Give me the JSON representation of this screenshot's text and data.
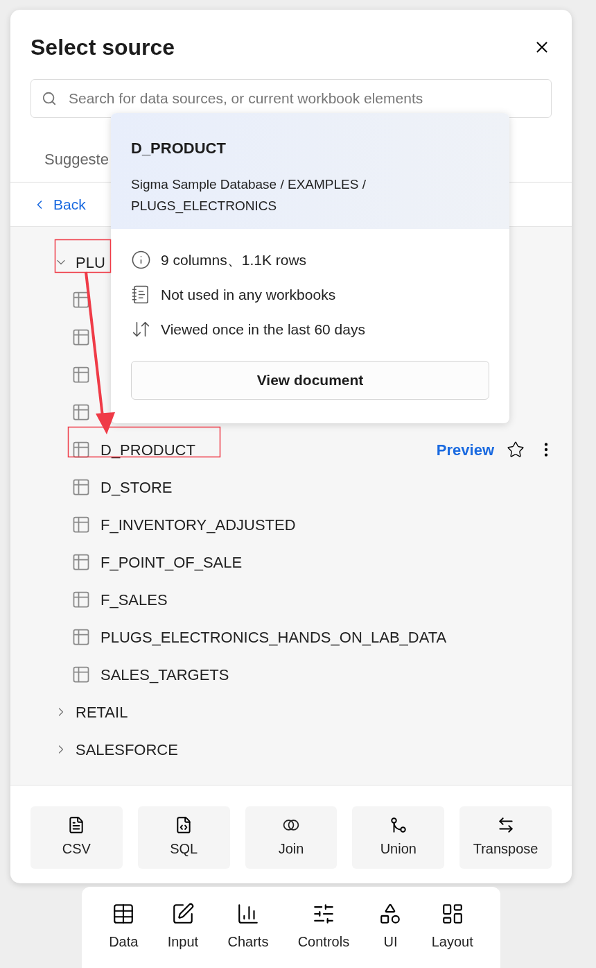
{
  "dialog": {
    "title": "Select source",
    "search": {
      "placeholder": "Search for data sources, or current workbook elements"
    },
    "tabs": [
      {
        "label": "Suggeste"
      }
    ],
    "back": "Back",
    "tree": [
      {
        "name": "PLU",
        "expanded": true,
        "children": [
          {
            "kind": "table",
            "hovered": false
          },
          {
            "kind": "table",
            "hovered": false
          },
          {
            "kind": "table",
            "hovered": false
          },
          {
            "kind": "table",
            "hovered": false
          },
          {
            "kind": "table",
            "name": "D_PRODUCT",
            "hovered": true,
            "action": "Preview",
            "starred": false
          },
          {
            "kind": "table",
            "name": "D_STORE",
            "hovered": false
          },
          {
            "kind": "table",
            "name": "F_INVENTORY_ADJUSTED",
            "hovered": false
          },
          {
            "kind": "table",
            "name": "F_POINT_OF_SALE",
            "hovered": false
          },
          {
            "kind": "table",
            "name": "F_SALES",
            "hovered": false
          },
          {
            "kind": "table",
            "name": "PLUGS_ELECTRONICS_HANDS_ON_LAB_DATA",
            "hovered": false
          },
          {
            "kind": "table",
            "name": "SALES_TARGETS",
            "hovered": false
          }
        ]
      },
      {
        "name": "RETAIL",
        "expanded": false
      },
      {
        "name": "SALESFORCE",
        "expanded": false
      }
    ],
    "actions": [
      {
        "kind": "csv",
        "label": "CSV"
      },
      {
        "kind": "sql",
        "label": "SQL"
      },
      {
        "kind": "join",
        "label": "Join"
      },
      {
        "kind": "union",
        "label": "Union"
      },
      {
        "kind": "transpose",
        "label": "Transpose"
      }
    ]
  },
  "popover": {
    "title": "D_PRODUCT",
    "path": "Sigma Sample Database / EXAMPLES / PLUGS_ELECTRONICS",
    "facts": [
      {
        "kind": "info",
        "text": "9 columns、1.1K rows"
      },
      {
        "kind": "usage",
        "text": "Not used in any workbooks"
      },
      {
        "kind": "views",
        "text": "Viewed once in the last 60 days"
      }
    ],
    "button": "View document"
  },
  "dock": [
    {
      "kind": "data",
      "label": "Data"
    },
    {
      "kind": "input",
      "label": "Input"
    },
    {
      "kind": "charts",
      "label": "Charts"
    },
    {
      "kind": "controls",
      "label": "Controls"
    },
    {
      "kind": "ui",
      "label": "UI"
    },
    {
      "kind": "layout",
      "label": "Layout"
    }
  ]
}
